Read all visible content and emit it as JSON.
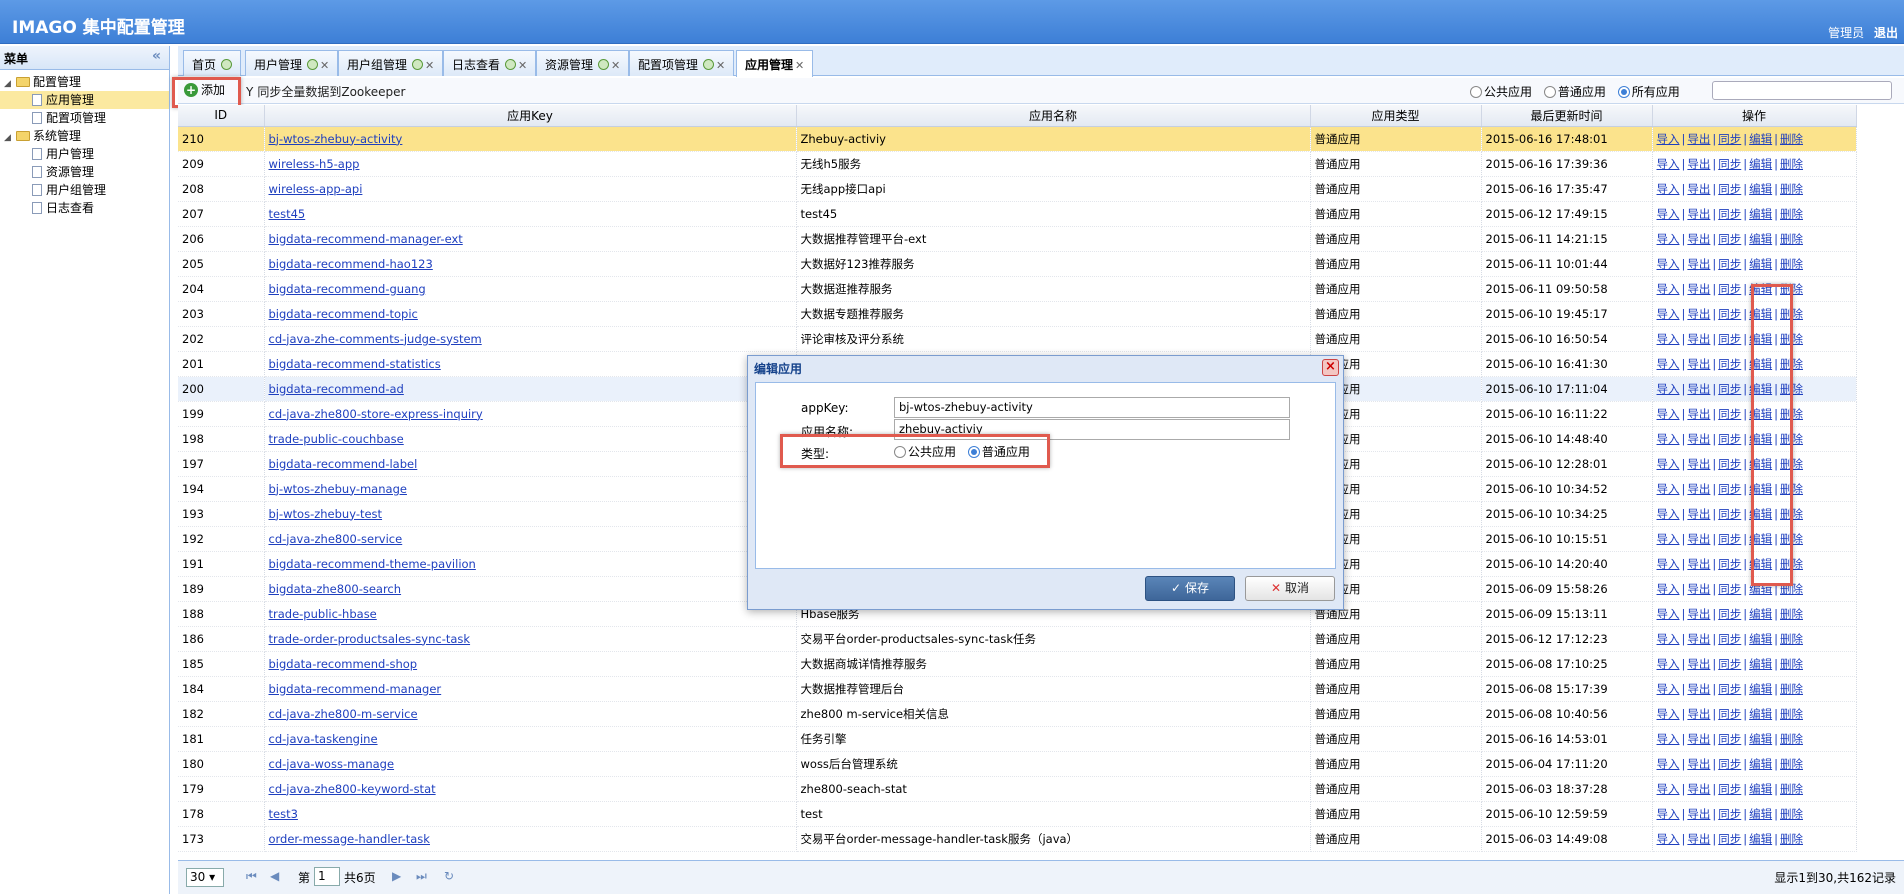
{
  "header": {
    "title": "IMAGO 集中配置管理",
    "user": "管理员",
    "logout": "退出"
  },
  "sidebar": {
    "title": "菜单",
    "collapse_icon": "«",
    "groups": [
      {
        "label": "配置管理",
        "items": [
          "应用管理",
          "配置项管理"
        ]
      },
      {
        "label": "系统管理",
        "items": [
          "用户管理",
          "资源管理",
          "用户组管理",
          "日志查看"
        ]
      }
    ]
  },
  "tabs": [
    {
      "label": "首页"
    },
    {
      "label": "用户管理"
    },
    {
      "label": "用户组管理"
    },
    {
      "label": "日志查看"
    },
    {
      "label": "资源管理"
    },
    {
      "label": "配置项管理"
    },
    {
      "label": "应用管理"
    }
  ],
  "toolbar": {
    "add_label": "添加",
    "sync_label": "同步全量数据到Zookeeper",
    "filter": {
      "options": [
        "公共应用",
        "普通应用",
        "所有应用"
      ],
      "selected": "所有应用"
    }
  },
  "grid": {
    "columns": [
      "ID",
      "应用Key",
      "应用名称",
      "应用类型",
      "最后更新时间",
      "操作"
    ],
    "ops": [
      "导入",
      "导出",
      "同步",
      "编辑",
      "删除"
    ],
    "rows": [
      [
        "210",
        "bj-wtos-zhebuy-activity",
        "Zhebuy-activiy",
        "普通应用",
        "2015-06-16 17:48:01"
      ],
      [
        "209",
        "wireless-h5-app",
        "无线h5服务",
        "普通应用",
        "2015-06-16 17:39:36"
      ],
      [
        "208",
        "wireless-app-api",
        "无线app接口api",
        "普通应用",
        "2015-06-16 17:35:47"
      ],
      [
        "207",
        "test45",
        "test45",
        "普通应用",
        "2015-06-12 17:49:15"
      ],
      [
        "206",
        "bigdata-recommend-manager-ext",
        "大数据推荐管理平台-ext",
        "普通应用",
        "2015-06-11 14:21:15"
      ],
      [
        "205",
        "bigdata-recommend-hao123",
        "大数据好123推荐服务",
        "普通应用",
        "2015-06-11 10:01:44"
      ],
      [
        "204",
        "bigdata-recommend-guang",
        "大数据逛推荐服务",
        "普通应用",
        "2015-06-11 09:50:58"
      ],
      [
        "203",
        "bigdata-recommend-topic",
        "大数据专题推荐服务",
        "普通应用",
        "2015-06-10 19:45:17"
      ],
      [
        "202",
        "cd-java-zhe-comments-judge-system",
        "评论审核及评分系统",
        "普通应用",
        "2015-06-10 16:50:54"
      ],
      [
        "201",
        "bigdata-recommend-statistics",
        "",
        "普通应用",
        "2015-06-10 16:41:30"
      ],
      [
        "200",
        "bigdata-recommend-ad",
        "",
        "普通应用",
        "2015-06-10 17:11:04"
      ],
      [
        "199",
        "cd-java-zhe800-store-express-inquiry",
        "",
        "普通应用",
        "2015-06-10 16:11:22"
      ],
      [
        "198",
        "trade-public-couchbase",
        "",
        "普通应用",
        "2015-06-10 14:48:40"
      ],
      [
        "197",
        "bigdata-recommend-label",
        "",
        "普通应用",
        "2015-06-10 12:28:01"
      ],
      [
        "194",
        "bj-wtos-zhebuy-manage",
        "",
        "普通应用",
        "2015-06-10 10:34:52"
      ],
      [
        "193",
        "bj-wtos-zhebuy-test",
        "",
        "普通应用",
        "2015-06-10 10:34:25"
      ],
      [
        "192",
        "cd-java-zhe800-service",
        "",
        "普通应用",
        "2015-06-10 10:15:51"
      ],
      [
        "191",
        "bigdata-recommend-theme-pavilion",
        "",
        "普通应用",
        "2015-06-10 14:20:40"
      ],
      [
        "189",
        "bigdata-zhe800-search",
        "",
        "普通应用",
        "2015-06-09 15:58:26"
      ],
      [
        "188",
        "trade-public-hbase",
        "Hbase服务",
        "普通应用",
        "2015-06-09 15:13:11"
      ],
      [
        "186",
        "trade-order-productsales-sync-task",
        "交易平台order-productsales-sync-task任务",
        "普通应用",
        "2015-06-12 17:12:23"
      ],
      [
        "185",
        "bigdata-recommend-shop",
        "大数据商城详情推荐服务",
        "普通应用",
        "2015-06-08 17:10:25"
      ],
      [
        "184",
        "bigdata-recommend-manager",
        "大数据推荐管理后台",
        "普通应用",
        "2015-06-08 15:17:39"
      ],
      [
        "182",
        "cd-java-zhe800-m-service",
        "zhe800 m-service相关信息",
        "普通应用",
        "2015-06-08 10:40:56"
      ],
      [
        "181",
        "cd-java-taskengine",
        "任务引擎",
        "普通应用",
        "2015-06-16 14:53:01"
      ],
      [
        "180",
        "cd-java-woss-manage",
        "woss后台管理系统",
        "普通应用",
        "2015-06-04 17:11:20"
      ],
      [
        "179",
        "cd-java-zhe800-keyword-stat",
        "zhe800-seach-stat",
        "普通应用",
        "2015-06-03 18:37:28"
      ],
      [
        "178",
        "test3",
        "test",
        "普通应用",
        "2015-06-10 12:59:59"
      ],
      [
        "173",
        "order-message-handler-task",
        "交易平台order-message-handler-task服务（java）",
        "普通应用",
        "2015-06-03 14:49:08"
      ]
    ]
  },
  "pager": {
    "page_size": "30",
    "page_prefix": "第",
    "page": "1",
    "page_suffix": "共6页",
    "info": "显示1到30,共162记录"
  },
  "dialog": {
    "title": "编辑应用",
    "appkey_label": "appKey:",
    "appkey_value": "bj-wtos-zhebuy-activity",
    "name_label": "应用名称:",
    "name_value": "zhebuy-activiy",
    "type_label": "类型:",
    "type_options": [
      "公共应用",
      "普通应用"
    ],
    "type_selected": "普通应用",
    "save_label": "保存",
    "cancel_label": "取消"
  }
}
